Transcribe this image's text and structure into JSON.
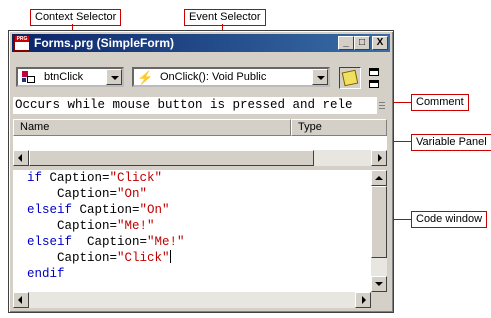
{
  "window": {
    "title": "Forms.prg (SimpleForm)",
    "min_glyph": "_",
    "max_glyph": "□",
    "close_glyph": "X"
  },
  "context_selector": {
    "value": "btnClick"
  },
  "event_selector": {
    "value": "OnClick(): Void Public"
  },
  "comment": {
    "text": "Occurs while mouse button is pressed and rele"
  },
  "variable_panel": {
    "columns": [
      "Name",
      "Type"
    ]
  },
  "code": {
    "lines": [
      [
        {
          "t": "if",
          "c": "kw"
        },
        {
          "t": " Caption=",
          "c": "id"
        },
        {
          "t": "\"Click\"",
          "c": "str"
        }
      ],
      [
        {
          "t": "    Caption=",
          "c": "id"
        },
        {
          "t": "\"On\"",
          "c": "str"
        }
      ],
      [
        {
          "t": "elseif",
          "c": "kw"
        },
        {
          "t": " Caption=",
          "c": "id"
        },
        {
          "t": "\"On\"",
          "c": "str"
        }
      ],
      [
        {
          "t": "    Caption=",
          "c": "id"
        },
        {
          "t": "\"Me!\"",
          "c": "str"
        }
      ],
      [
        {
          "t": "elseif",
          "c": "kw"
        },
        {
          "t": "  Caption=",
          "c": "id"
        },
        {
          "t": "\"Me!\"",
          "c": "str"
        }
      ],
      [
        {
          "t": "    Caption=",
          "c": "id"
        },
        {
          "t": "\"Click\"",
          "c": "str"
        },
        {
          "t": "",
          "c": "caret"
        }
      ],
      [
        {
          "t": "endif",
          "c": "kw"
        }
      ]
    ]
  },
  "callouts": {
    "context_selector": "Context Selector",
    "event_selector": "Event Selector",
    "comment": "Comment",
    "variable_panel": "Variable Panel",
    "code_window": "Code window"
  },
  "colors": {
    "keyword": "#0000c0",
    "string": "#c00000",
    "callout": "#cc0000",
    "titlebar": "#0a246a"
  }
}
